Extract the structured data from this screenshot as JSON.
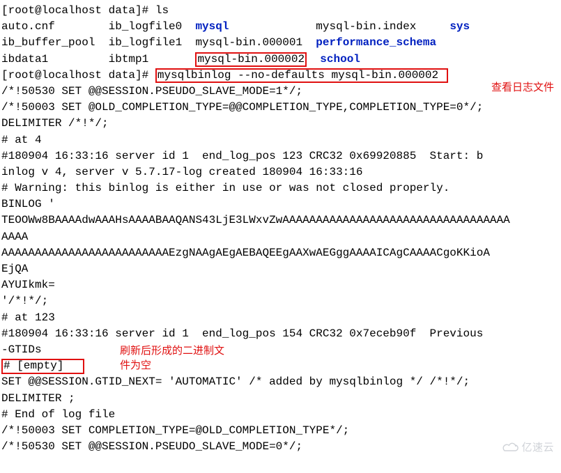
{
  "prompt1": "[root@localhost data]# ",
  "cmd1": "ls",
  "ls": {
    "r1": {
      "c1": "auto.cnf",
      "c2": "ib_logfile0",
      "c3": "mysql",
      "c4": "mysql-bin.index",
      "c5": "sys"
    },
    "r2": {
      "c1": "ib_buffer_pool",
      "c2": "ib_logfile1",
      "c3": "mysql-bin.000001",
      "c4": "performance_schema"
    },
    "r3": {
      "c1": "ibdata1",
      "c2": "ibtmp1",
      "c3": "mysql-bin.000002",
      "c4": "school"
    }
  },
  "prompt2": "[root@localhost data]# ",
  "cmd2": "mysqlbinlog --no-defaults mysql-bin.000002",
  "anno1": "查看日志文件",
  "out": {
    "l1": "/*!50530 SET @@SESSION.PSEUDO_SLAVE_MODE=1*/;",
    "l2": "/*!50003 SET @OLD_COMPLETION_TYPE=@@COMPLETION_TYPE,COMPLETION_TYPE=0*/;",
    "l3": "DELIMITER /*!*/;",
    "l4": "# at 4",
    "l5": "#180904 16:33:16 server id 1  end_log_pos 123 CRC32 0x69920885  Start: b",
    "l6": "inlog v 4, server v 5.7.17-log created 180904 16:33:16",
    "l7": "# Warning: this binlog is either in use or was not closed properly.",
    "l8": "BINLOG '",
    "l9": "TEOOWw8BAAAAdwAAAHsAAAABAAQANS43LjE3LWxvZwAAAAAAAAAAAAAAAAAAAAAAAAAAAAAAAAAA",
    "l10": "AAAA",
    "l11": "AAAAAAAAAAAAAAAAAAAAAAAAAEzgNAAgAEgAEBAQEEgAAXwAEGggAAAAICAgCAAAACgoKKioA",
    "l12": "EjQA",
    "l13": "AYUIkmk=",
    "l14": "'/*!*/;",
    "l15": "# at 123",
    "l16": "#180904 16:33:16 server id 1  end_log_pos 154 CRC32 0x7eceb90f  Previous",
    "l17": "-GTIDs",
    "l18": "# [empty]",
    "l19": "SET @@SESSION.GTID_NEXT= 'AUTOMATIC' /* added by mysqlbinlog */ /*!*/;",
    "l20": "DELIMITER ;",
    "l21": "# End of log file",
    "l22": "/*!50003 SET COMPLETION_TYPE=@OLD_COMPLETION_TYPE*/;",
    "l23": "/*!50530 SET @@SESSION.PSEUDO_SLAVE_MODE=0*/;"
  },
  "anno2a": "刷新后形成的二进制文",
  "anno2b": "件为空",
  "watermark": "亿速云"
}
